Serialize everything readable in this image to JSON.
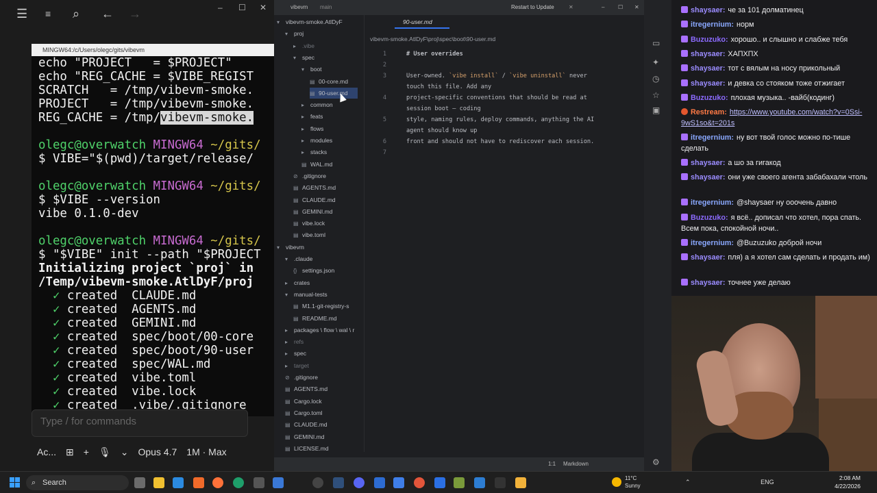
{
  "left_app": {
    "terminal_title": "MINGW64:/c/Users/olegc/gits/vibevm",
    "terminal_lines": [
      "echo \"PROJECT   = $PROJECT\"",
      "echo \"REG_CACHE = $VIBE_REGIST",
      "SCRATCH   = /tmp/vibevm-smoke.",
      "PROJECT   = /tmp/vibevm-smoke.",
      "REG_CACHE = /tmp/",
      "",
      "olegc@overwatch ",
      "$ VIBE=\"$(pwd)/target/release/",
      "",
      "olegc@overwatch ",
      "$ $VIBE --version",
      "vibe 0.1.0-dev",
      "",
      "olegc@overwatch ",
      "$ \"$VIBE\" init --path \"$PROJECT",
      "Initializing project `proj` in",
      "/Temp/vibevm-smoke.AtlDyF/proj",
      "  ✓ created  CLAUDE.md",
      "  ✓ created  AGENTS.md",
      "  ✓ created  GEMINI.md",
      "  ✓ created  spec/boot/00-core",
      "  ✓ created  spec/boot/90-user",
      "  ✓ created  spec/WAL.md",
      "  ✓ created  vibe.toml",
      "  ✓ created  vibe.lock",
      "  ✓ created  .vibe/.gitignore"
    ],
    "highlight_text": "vibevm-smoke.",
    "mingw_label": "MINGW64",
    "path_suffix": "~/gits/",
    "prompt_placeholder": "Type / for commands",
    "bottom_labels": [
      "Ac...",
      "⊞",
      "+",
      "🎙",
      "⌄",
      "Opus 4.7",
      "1M · Max"
    ]
  },
  "ide": {
    "project_name": "vibevm",
    "branch": "main",
    "restart_label": "Restart to Update",
    "tab_label": "90-user.md",
    "breadcrumb": "vibevm-smoke.AtlDyF\\proj\\spec\\boot\\90-user.md",
    "tree": [
      {
        "label": "vibevm-smoke.AtlDyF",
        "depth": 0,
        "icon": "▾"
      },
      {
        "label": "proj",
        "depth": 1,
        "icon": "▾"
      },
      {
        "label": ".vibe",
        "depth": 2,
        "icon": "▸",
        "dim": true
      },
      {
        "label": "spec",
        "depth": 2,
        "icon": "▾"
      },
      {
        "label": "boot",
        "depth": 3,
        "icon": "▾"
      },
      {
        "label": "00-core.md",
        "depth": 4,
        "icon": "▤"
      },
      {
        "label": "90-user.md",
        "depth": 4,
        "icon": "▤",
        "selected": true
      },
      {
        "label": "common",
        "depth": 3,
        "icon": "▸"
      },
      {
        "label": "feats",
        "depth": 3,
        "icon": "▸"
      },
      {
        "label": "flows",
        "depth": 3,
        "icon": "▸"
      },
      {
        "label": "modules",
        "depth": 3,
        "icon": "▸"
      },
      {
        "label": "stacks",
        "depth": 3,
        "icon": "▸"
      },
      {
        "label": "WAL.md",
        "depth": 3,
        "icon": "▤"
      },
      {
        "label": ".gitignore",
        "depth": 2,
        "icon": "⊘"
      },
      {
        "label": "AGENTS.md",
        "depth": 2,
        "icon": "▤"
      },
      {
        "label": "CLAUDE.md",
        "depth": 2,
        "icon": "▤"
      },
      {
        "label": "GEMINI.md",
        "depth": 2,
        "icon": "▤"
      },
      {
        "label": "vibe.lock",
        "depth": 2,
        "icon": "▤"
      },
      {
        "label": "vibe.toml",
        "depth": 2,
        "icon": "▤"
      },
      {
        "label": "vibevm",
        "depth": 0,
        "icon": "▾"
      },
      {
        "label": ".claude",
        "depth": 1,
        "icon": "▾"
      },
      {
        "label": "settings.json",
        "depth": 2,
        "icon": "{}"
      },
      {
        "label": "crates",
        "depth": 1,
        "icon": "▸"
      },
      {
        "label": "manual-tests",
        "depth": 1,
        "icon": "▾"
      },
      {
        "label": "M1.1-git-registry-s",
        "depth": 2,
        "icon": "▤"
      },
      {
        "label": "README.md",
        "depth": 2,
        "icon": "▤"
      },
      {
        "label": "packages \\ flow \\ wal \\ r",
        "depth": 1,
        "icon": "▸"
      },
      {
        "label": "refs",
        "depth": 1,
        "icon": "▸",
        "dim": true
      },
      {
        "label": "spec",
        "depth": 1,
        "icon": "▸"
      },
      {
        "label": "target",
        "depth": 1,
        "icon": "▸",
        "dim": true
      },
      {
        "label": ".gitignore",
        "depth": 1,
        "icon": "⊘"
      },
      {
        "label": "AGENTS.md",
        "depth": 1,
        "icon": "▤"
      },
      {
        "label": "Cargo.lock",
        "depth": 1,
        "icon": "▤"
      },
      {
        "label": "Cargo.toml",
        "depth": 1,
        "icon": "▤"
      },
      {
        "label": "CLAUDE.md",
        "depth": 1,
        "icon": "▤"
      },
      {
        "label": "GEMINI.md",
        "depth": 1,
        "icon": "▤"
      },
      {
        "label": "LICENSE.md",
        "depth": 1,
        "icon": "▤"
      }
    ],
    "editor_lines": [
      {
        "num": "1",
        "text": "# User overrides"
      },
      {
        "num": "2",
        "text": ""
      },
      {
        "num": "3",
        "text": "User-owned. `vibe install` / `vibe uninstall` never"
      },
      {
        "num": "",
        "text": "touch this file. Add any"
      },
      {
        "num": "4",
        "text": "project-specific conventions that should be read at"
      },
      {
        "num": "",
        "text": "session boot — coding"
      },
      {
        "num": "5",
        "text": "style, naming rules, deploy commands, anything the AI"
      },
      {
        "num": "",
        "text": "agent should know up"
      },
      {
        "num": "6",
        "text": "front and should not have to rediscover each session."
      },
      {
        "num": "7",
        "text": ""
      }
    ],
    "status_position": "1:1",
    "status_lang": "Markdown"
  },
  "chat": {
    "messages": [
      {
        "user": "shaysaer",
        "color": "shay",
        "text": "че за 101 долматинец"
      },
      {
        "user": "itregernium",
        "color": "itreg",
        "text": "норм"
      },
      {
        "user": "Buzuzuko",
        "color": "buzu",
        "text": "хорошо.. и слышно и слабже тебя"
      },
      {
        "user": "shaysaer",
        "color": "shay",
        "text": "ХАПХПХ"
      },
      {
        "user": "shaysaer",
        "color": "shay",
        "text": "тот с вялым на носу прикольный"
      },
      {
        "user": "shaysaer",
        "color": "shay",
        "text": "и девка со стояком тоже отжигает"
      },
      {
        "user": "Buzuzuko",
        "color": "buzu",
        "text": "плохая музыка.. -вайб(кодинг)"
      },
      {
        "user": "Restream",
        "color": "rest",
        "text": "",
        "link": "https://www.youtube.com/watch?v=0Ssi-9wS1so&t=201s"
      },
      {
        "user": "itregernium",
        "color": "itreg",
        "text": "ну вот твой голос можно по-тише сделать"
      },
      {
        "user": "shaysaer",
        "color": "shay",
        "text": "а шо за гигакод"
      },
      {
        "user": "shaysaer",
        "color": "shay",
        "text": "они уже своего агента забабахали чтоль"
      },
      {
        "user": "itregernium",
        "color": "itreg",
        "text": "@shaysaer ну ооочень давно"
      },
      {
        "user": "Buzuzuko",
        "color": "buzu",
        "text": "я всё.. дописал что хотел, пора спать. Всем пока, спокойной ночи.."
      },
      {
        "user": "itregernium",
        "color": "itreg",
        "text": "@Buzuzuko доброй ночи"
      },
      {
        "user": "shaysaer",
        "color": "shay",
        "text": "пля) а я хотел сам сделать и продать им)"
      },
      {
        "user": "shaysaer",
        "color": "shay",
        "text": "точнее уже делаю"
      }
    ]
  },
  "taskbar": {
    "search_label": "Search",
    "weather_temp": "11°C",
    "weather_text": "Sunny",
    "lang": "ENG",
    "time": "2:08 AM",
    "date": "4/22/2026"
  },
  "colors": {
    "accent": "#3574f0",
    "terminal_green": "#4fd26a",
    "terminal_magenta": "#c86bd1",
    "terminal_yellow": "#d5c54b"
  }
}
